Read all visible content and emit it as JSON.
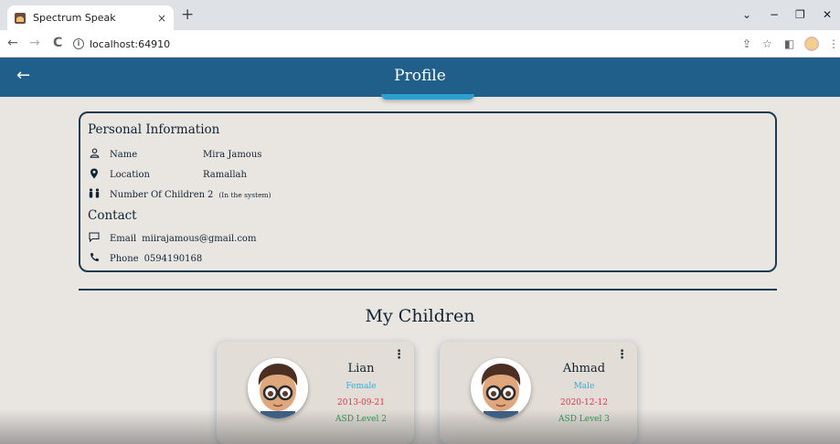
{
  "browser": {
    "tab_title": "Spectrum Speak",
    "tab_close": "×",
    "new_tab": "+",
    "url": "localhost:64910",
    "controls": {
      "collapse": "⌄",
      "minimize": "−",
      "restore": "❐",
      "close": "✕"
    },
    "nav": {
      "back": "←",
      "forward": "→",
      "reload": "C"
    },
    "toolbar": {
      "share": "⇪",
      "bookmark": "☆",
      "sidepanel": "◧",
      "menu": "⋮"
    }
  },
  "header": {
    "back": "←",
    "title": "Profile"
  },
  "personal": {
    "title": "Personal Information",
    "name_label": "Name",
    "name_value": "Mira Jamous",
    "location_label": "Location",
    "location_value": "Ramallah",
    "children_label": "Number Of Children",
    "children_value": "2",
    "children_note": "(In the system)"
  },
  "contact": {
    "title": "Contact",
    "email_label": "Email",
    "email_value": "miirajamous@gmail.com",
    "phone_label": "Phone",
    "phone_value": "0594190168"
  },
  "children_title": "My Children",
  "children": [
    {
      "name": "Lian",
      "gender": "Female",
      "dob": "2013-09-21",
      "asd": "ASD Level 2",
      "menu": "⋮"
    },
    {
      "name": "Ahmad",
      "gender": "Male",
      "dob": "2020-12-12",
      "asd": "ASD Level 3",
      "menu": "⋮"
    }
  ],
  "colors": {
    "appbar": "#1f5f8a",
    "accent": "#2a9fd2",
    "background": "#e9e5e1",
    "gender": "#2fb0d9",
    "dob": "#e0334c",
    "asd": "#1e9a4a"
  }
}
